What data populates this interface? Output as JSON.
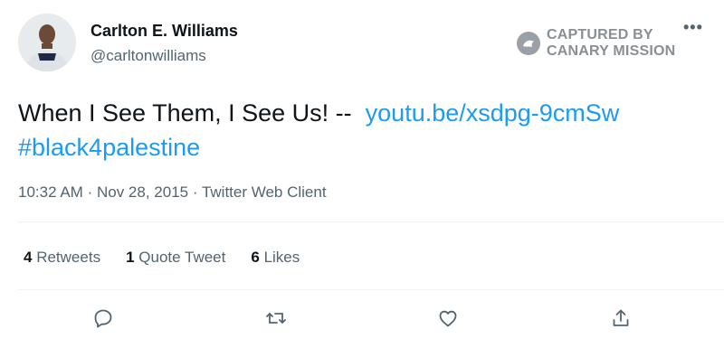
{
  "tweet": {
    "author_name": "Carlton E. Williams",
    "author_handle": "@carltonwilliams",
    "text_main": "When I See Them, I See Us! --",
    "link_text": "youtu.be/xsdpg-9cmSw",
    "hashtag": "#black4palestine",
    "meta": {
      "time": "10:32 AM",
      "date": "Nov 28, 2015",
      "client": "Twitter Web Client",
      "separator": "·"
    },
    "stats": {
      "retweets_count": "4",
      "retweets_label": "Retweets",
      "quote_count": "1",
      "quote_label": "Quote Tweet",
      "likes_count": "6",
      "likes_label": "Likes"
    },
    "more_label": "•••",
    "link_color": "#1d9bf0"
  },
  "watermark": {
    "line1": "CAPTURED BY",
    "line2": "CANARY MISSION"
  },
  "icons": {
    "avatar": "avatar-photo",
    "reply": "reply-icon",
    "retweet": "retweet-icon",
    "like": "like-icon",
    "share": "share-icon",
    "watermark": "canary-bird-icon"
  }
}
